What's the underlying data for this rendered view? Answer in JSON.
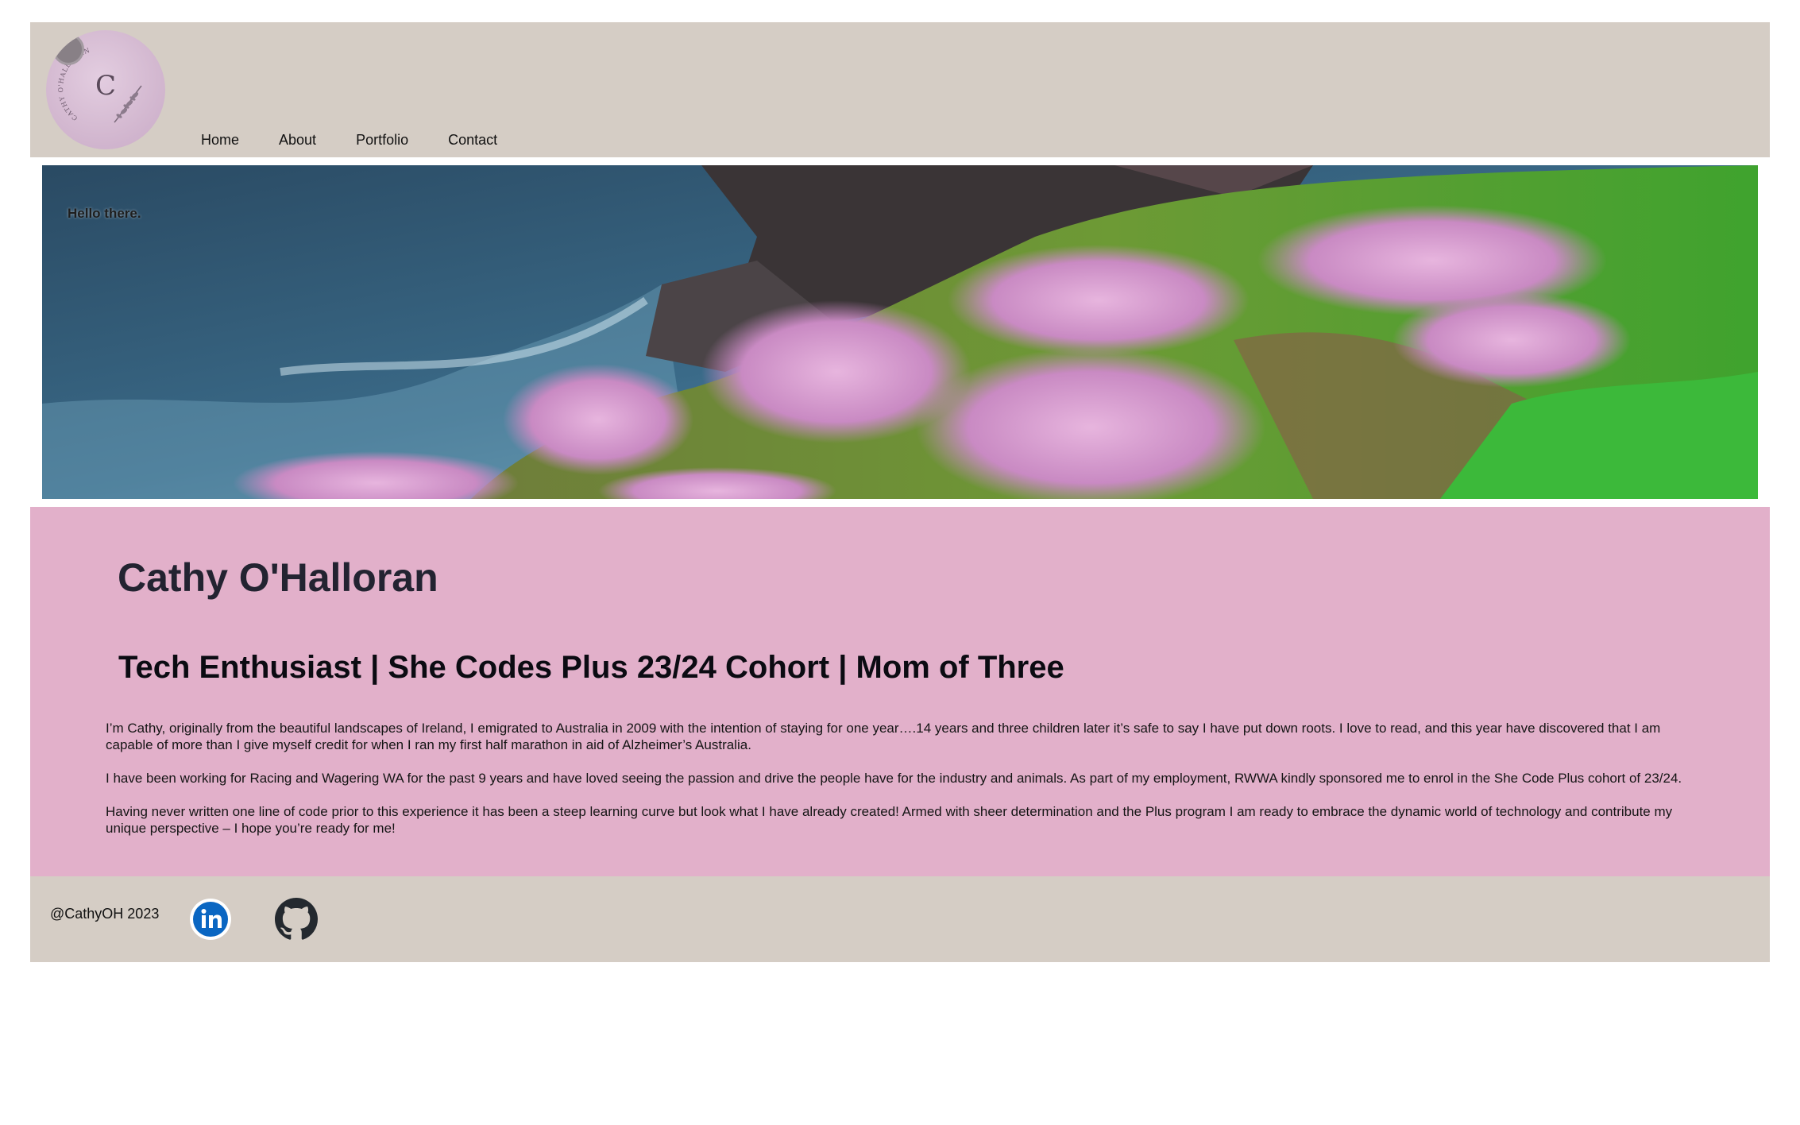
{
  "header": {
    "logo": {
      "letter": "C",
      "ring_text": "CATHY O'HALLORAN"
    },
    "nav": [
      {
        "label": "Home"
      },
      {
        "label": "About"
      },
      {
        "label": "Portfolio"
      },
      {
        "label": "Contact"
      }
    ]
  },
  "hero": {
    "greeting": "Hello there."
  },
  "about": {
    "name": "Cathy O'Halloran",
    "tagline": "Tech Enthusiast | She Codes Plus 23/24 Cohort | Mom of Three",
    "paragraphs": [
      "I’m Cathy, originally from the beautiful landscapes of Ireland, I emigrated to Australia in 2009 with the intention of staying for one year….14 years and three children later it’s safe to say I have put down roots. I love to read, and this year have discovered that I am capable of more than I give myself credit for when I ran my first half marathon in aid of Alzheimer’s Australia.",
      "I have been working for Racing and Wagering WA for the past 9 years and have loved seeing the passion and drive the people have for the industry and animals. As part of my employment, RWWA kindly sponsored me to enrol in the She Code Plus cohort of 23/24.",
      "Having never written one line of code prior to this experience it has been a steep learning curve but look what I have already created! Armed with sheer determination and the Plus program I am ready to embrace the dynamic world of technology and contribute my unique perspective – I hope you’re ready for me!"
    ]
  },
  "footer": {
    "copyright": "@CathyOH 2023",
    "social": [
      {
        "icon": "linkedin-icon"
      },
      {
        "icon": "github-icon"
      }
    ]
  },
  "colors": {
    "header_bg": "#d5cdc5",
    "about_bg": "#e2b0ca",
    "footer_bg": "#d5cdc5",
    "linkedin_blue": "#0a66c2"
  }
}
